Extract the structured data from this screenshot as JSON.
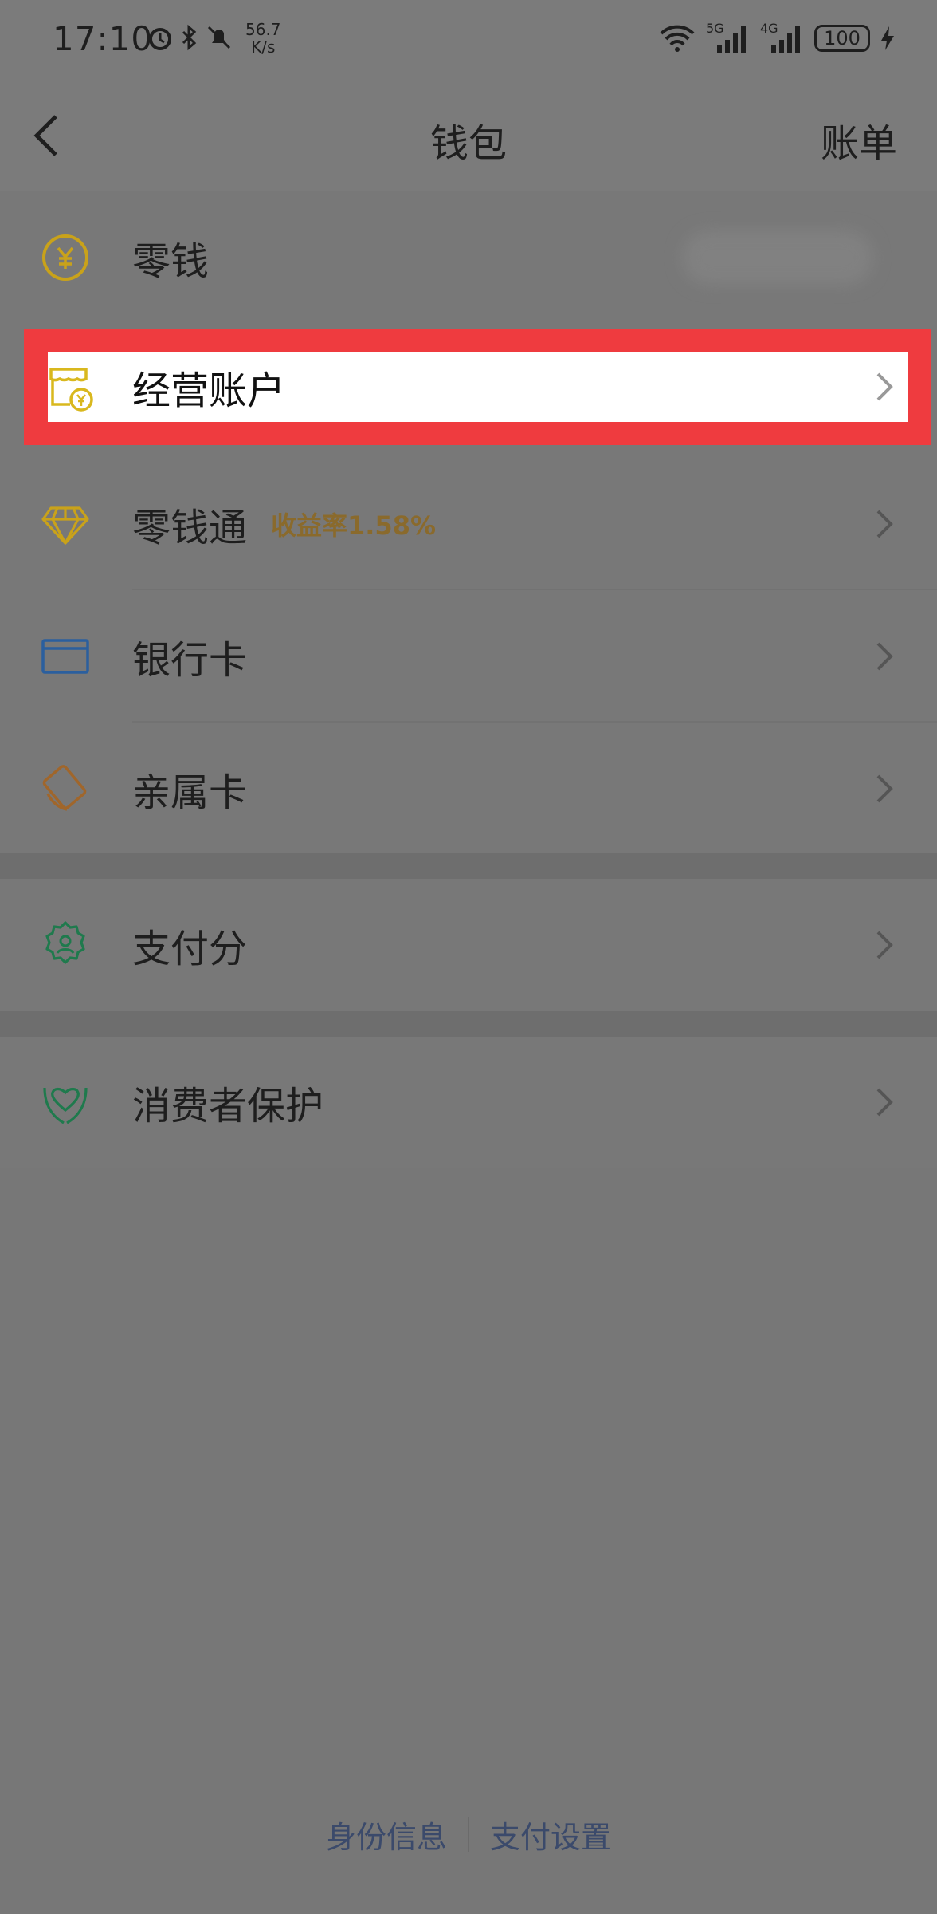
{
  "status_bar": {
    "time": "17:10",
    "net_speed_value": "56.7",
    "net_speed_unit": "K/s",
    "signal_1_label": "5G",
    "signal_2_label": "4G",
    "battery": "100"
  },
  "nav": {
    "title": "钱包",
    "right_link": "账单"
  },
  "items": [
    {
      "label": "零钱",
      "icon": "yuan-coin-icon",
      "amount_hidden": true
    },
    {
      "label": "经营账户",
      "icon": "business-account-icon"
    },
    {
      "label": "零钱通",
      "icon": "diamond-icon",
      "badge": "收益率1.58%"
    },
    {
      "label": "银行卡",
      "icon": "bank-card-icon"
    },
    {
      "label": "亲属卡",
      "icon": "family-card-icon"
    },
    {
      "label": "支付分",
      "icon": "pay-score-icon"
    },
    {
      "label": "消费者保护",
      "icon": "consumer-protection-icon"
    }
  ],
  "footer": {
    "left_link": "身份信息",
    "right_link": "支付设置"
  },
  "colors": {
    "highlight_border": "#ef3b3f",
    "badge": "#8a6a2c",
    "gold_icon": "#c9a21a",
    "blue_icon": "#2b5f9e",
    "green_icon": "#1f7a4d"
  }
}
